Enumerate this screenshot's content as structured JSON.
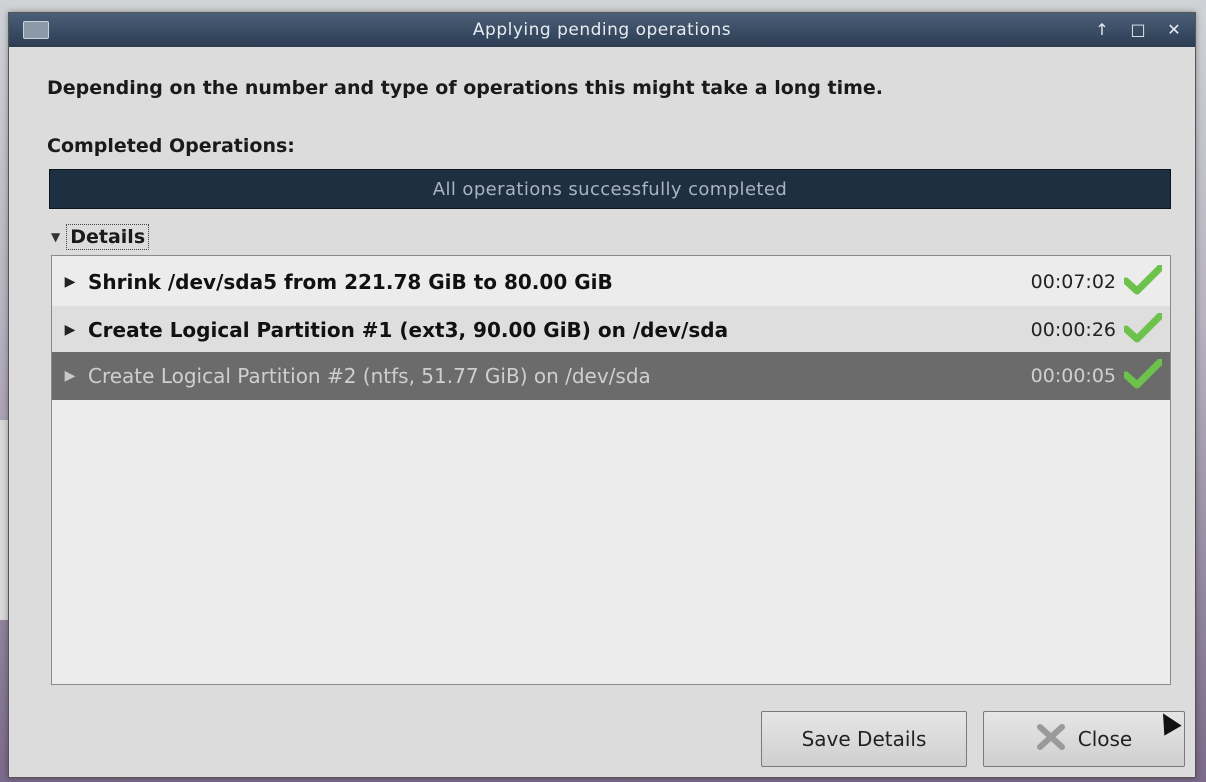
{
  "window": {
    "title": "Applying pending operations",
    "title_buttons": [
      "↑",
      "□",
      "✕"
    ]
  },
  "dialog": {
    "description": "Depending on the number and type of operations this might take a long time.",
    "section_label": "Completed Operations:",
    "progress": {
      "text": "All operations successfully completed",
      "fraction": 1.0
    },
    "details_label": "Details",
    "operations": [
      {
        "description": "Shrink /dev/sda5 from 221.78 GiB to 80.00 GiB",
        "time": "00:07:02",
        "status": "success"
      },
      {
        "description": "Create Logical Partition #1 (ext3, 90.00 GiB) on /dev/sda",
        "time": "00:00:26",
        "status": "success"
      },
      {
        "description": "Create Logical Partition #2 (ntfs, 51.77 GiB) on /dev/sda",
        "time": "00:00:05",
        "status": "success"
      }
    ],
    "buttons": {
      "save_details": "Save Details",
      "close": "Close"
    }
  },
  "colors": {
    "titlebar": "#2c3d52",
    "progress_bar": "#1c2a3a",
    "selected_row": "#6b6b6b",
    "check_green": "#6cc24a"
  }
}
